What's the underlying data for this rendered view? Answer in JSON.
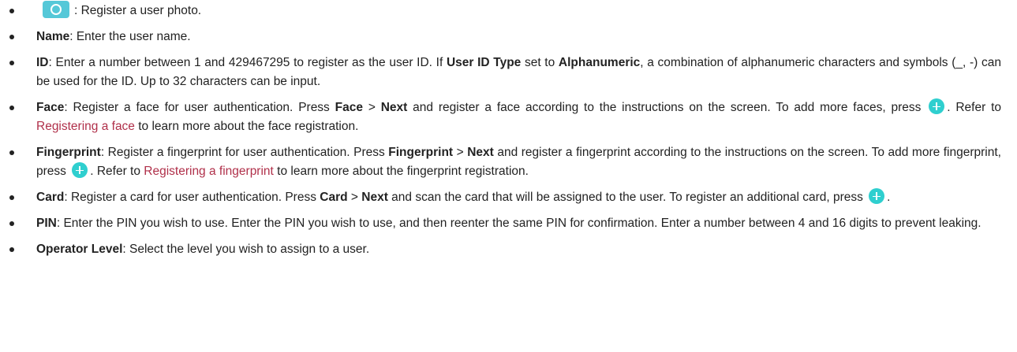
{
  "items": [
    {
      "parts": [
        {
          "t": "icon",
          "name": "camera-icon"
        },
        {
          "t": "text",
          "v": ": Register a user photo."
        }
      ]
    },
    {
      "parts": [
        {
          "t": "bold",
          "v": "Name"
        },
        {
          "t": "text",
          "v": ": Enter the user name."
        }
      ]
    },
    {
      "justify": true,
      "parts": [
        {
          "t": "bold",
          "v": "ID"
        },
        {
          "t": "text",
          "v": ": Enter a number between 1 and 429467295 to register as the user ID. If "
        },
        {
          "t": "bold",
          "v": "User ID Type"
        },
        {
          "t": "text",
          "v": " set to "
        },
        {
          "t": "bold",
          "v": "Alphanumeric"
        },
        {
          "t": "text",
          "v": ", a combination of alphanumeric characters and symbols (_, -) can be used for the ID. Up to 32 characters can be input."
        }
      ]
    },
    {
      "justify": true,
      "parts": [
        {
          "t": "bold",
          "v": "Face"
        },
        {
          "t": "text",
          "v": ": Register a face for user authentication. Press "
        },
        {
          "t": "bold",
          "v": "Face"
        },
        {
          "t": "text",
          "v": " > "
        },
        {
          "t": "bold",
          "v": "Next"
        },
        {
          "t": "text",
          "v": " and register a face according to the instructions on the screen. To add more faces, press "
        },
        {
          "t": "icon",
          "name": "plus-icon"
        },
        {
          "t": "text",
          "v": ". Refer to "
        },
        {
          "t": "link",
          "v": "Registering a face"
        },
        {
          "t": "text",
          "v": " to learn more about the face registration."
        }
      ]
    },
    {
      "justify": true,
      "parts": [
        {
          "t": "bold",
          "v": "Fingerprint"
        },
        {
          "t": "text",
          "v": ": Register a fingerprint for user authentication. Press "
        },
        {
          "t": "bold",
          "v": "Fingerprint"
        },
        {
          "t": "text",
          "v": " > "
        },
        {
          "t": "bold",
          "v": "Next"
        },
        {
          "t": "text",
          "v": " and register a fingerprint according to the instructions on the screen. To add more fingerprint, press "
        },
        {
          "t": "icon",
          "name": "plus-icon"
        },
        {
          "t": "text",
          "v": ". Refer to "
        },
        {
          "t": "link",
          "v": "Registering a fingerprint"
        },
        {
          "t": "text",
          "v": " to learn more about the fingerprint registration."
        }
      ]
    },
    {
      "justify": true,
      "parts": [
        {
          "t": "bold",
          "v": "Card"
        },
        {
          "t": "text",
          "v": ": Register a card for user authentication. Press "
        },
        {
          "t": "bold",
          "v": "Card"
        },
        {
          "t": "text",
          "v": " > "
        },
        {
          "t": "bold",
          "v": "Next"
        },
        {
          "t": "text",
          "v": " and scan the card that will be assigned to the user. To register an additional card, press "
        },
        {
          "t": "icon",
          "name": "plus-icon"
        },
        {
          "t": "text",
          "v": "."
        }
      ]
    },
    {
      "justify": true,
      "parts": [
        {
          "t": "bold",
          "v": "PIN"
        },
        {
          "t": "text",
          "v": ": Enter the PIN you wish to use. Enter the PIN you wish to use, and then reenter the same PIN for confirmation. Enter a number between 4 and 16 digits to prevent leaking."
        }
      ]
    },
    {
      "parts": [
        {
          "t": "bold",
          "v": "Operator Level"
        },
        {
          "t": "text",
          "v": ": Select the level you wish to assign to a user."
        }
      ]
    }
  ]
}
